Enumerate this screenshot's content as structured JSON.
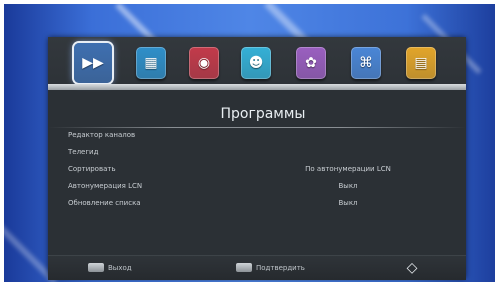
{
  "menu": {
    "title": "Программы",
    "items": [
      {
        "label": "Редактор каналов",
        "value": ""
      },
      {
        "label": "Телегид",
        "value": ""
      },
      {
        "label": "Сортировать",
        "value": "По автонумерации LCN"
      },
      {
        "label": "Автонумерация LCN",
        "value": "Выкл"
      },
      {
        "label": "Обновление списка",
        "value": "Выкл"
      }
    ]
  },
  "top_icons": [
    {
      "name": "programs-icon",
      "color": "#3e6fb0",
      "glyph": "▶▶",
      "selected": true
    },
    {
      "name": "picture-icon",
      "color": "#2f8fc9",
      "glyph": "▦",
      "selected": false
    },
    {
      "name": "globe-icon",
      "color": "#c23a4a",
      "glyph": "◉",
      "selected": false
    },
    {
      "name": "mascot-icon",
      "color": "#34b0d6",
      "glyph": "☻",
      "selected": false
    },
    {
      "name": "media-icon",
      "color": "#9a5fc0",
      "glyph": "✿",
      "selected": false
    },
    {
      "name": "network-icon",
      "color": "#4a86d6",
      "glyph": "⌘",
      "selected": false
    },
    {
      "name": "archive-icon",
      "color": "#e2a52a",
      "glyph": "▤",
      "selected": false
    }
  ],
  "footer": {
    "exit_label": "Выход",
    "confirm_label": "Подтвердить",
    "nav_icon": "dpad-icon"
  },
  "colors": {
    "panel": "#2b3035",
    "background_blue": "#4f86e6",
    "text": "#c9ced3"
  }
}
